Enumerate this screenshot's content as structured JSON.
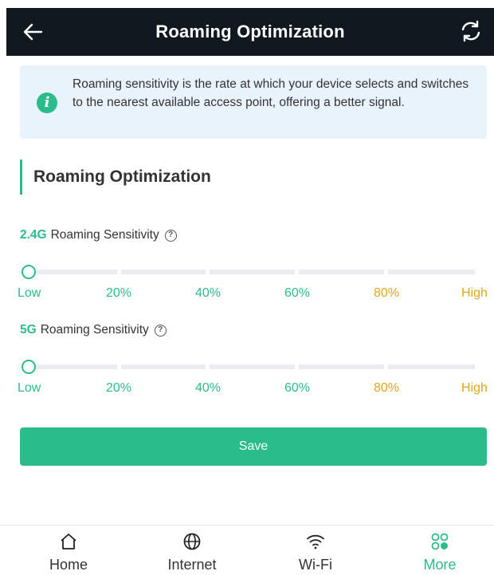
{
  "header": {
    "title": "Roaming Optimization",
    "back_icon": "arrow-left-icon",
    "refresh_icon": "refresh-icon"
  },
  "info": {
    "icon": "info-icon",
    "icon_glyph": "i",
    "text": "Roaming sensitivity is the rate at which your device selects and switches to the nearest available access point, offering a better signal."
  },
  "section": {
    "title": "Roaming Optimization"
  },
  "sliders": [
    {
      "band": "2.4G",
      "label": "Roaming Sensitivity",
      "help_glyph": "?",
      "value": "Low",
      "ticks": [
        "Low",
        "20%",
        "40%",
        "60%",
        "80%",
        "High"
      ]
    },
    {
      "band": "5G",
      "label": "Roaming Sensitivity",
      "help_glyph": "?",
      "value": "Low",
      "ticks": [
        "Low",
        "20%",
        "40%",
        "60%",
        "80%",
        "High"
      ]
    }
  ],
  "save_label": "Save",
  "nav": [
    {
      "label": "Home",
      "icon": "home-icon",
      "active": false
    },
    {
      "label": "Internet",
      "icon": "globe-icon",
      "active": false
    },
    {
      "label": "Wi-Fi",
      "icon": "wifi-icon",
      "active": false
    },
    {
      "label": "More",
      "icon": "more-apps-icon",
      "active": true
    }
  ],
  "colors": {
    "accent": "#2bbc8c",
    "warning_tick": "#e0a818",
    "header_bg": "#101820",
    "info_bg": "#e9f3fc"
  }
}
